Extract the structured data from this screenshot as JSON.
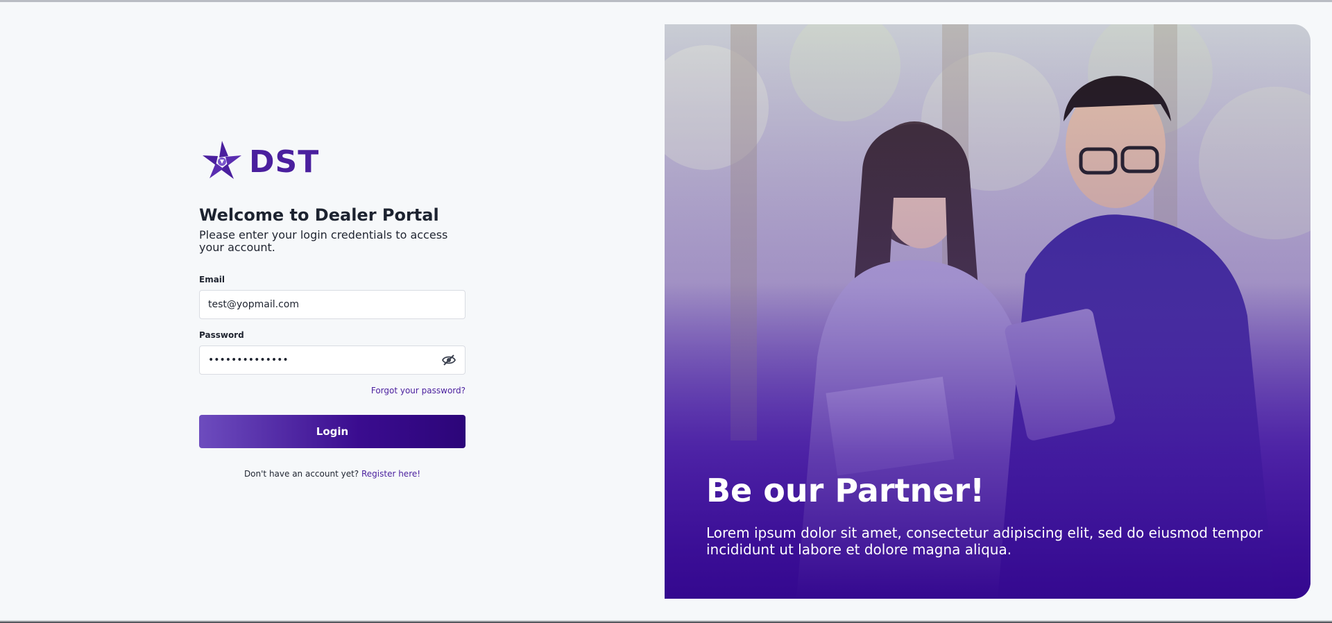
{
  "brand": {
    "name": "DST",
    "color": "#4a1f9e",
    "logo_icon": "star-flower-icon"
  },
  "login": {
    "title": "Welcome to Dealer Portal",
    "subtitle": "Please enter your login credentials to access your account.",
    "email_label": "Email",
    "email_value": "test@yopmail.com",
    "password_label": "Password",
    "password_value": "••••••••••••••",
    "password_toggle_icon": "eye-slash-icon",
    "forgot_label": "Forgot your password?",
    "login_label": "Login",
    "register_prompt": "Don't have an account yet?",
    "register_link": "Register here!"
  },
  "hero": {
    "title": "Be our Partner!",
    "text": "Lorem ipsum dolor sit amet, consectetur adipiscing elit, sed do eiusmod tempor incididunt ut labore et dolore magna aliqua.",
    "image": "photo of two colleagues looking at a tablet"
  },
  "colors": {
    "accent": "#4a1f9e",
    "button_start": "#6d4cbe",
    "button_end": "#2c0579",
    "background": "#f6f8fa"
  }
}
